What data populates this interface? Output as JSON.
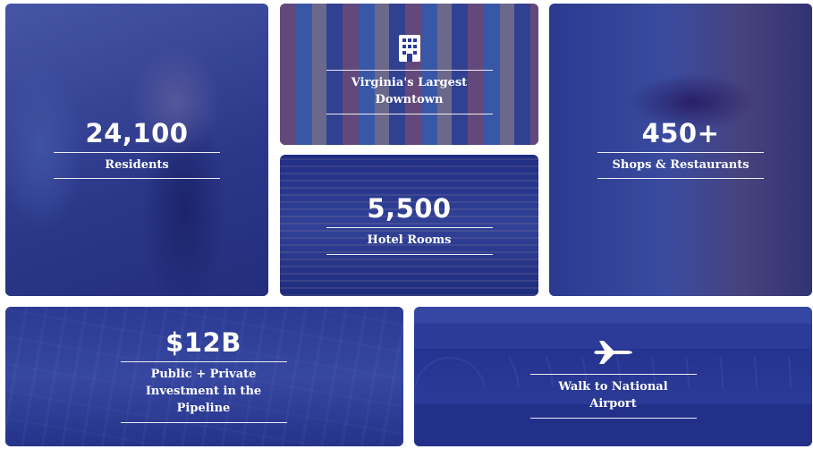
{
  "tiles": {
    "residents": {
      "stat": "24,100",
      "label": "Residents"
    },
    "downtown": {
      "label_line1": "Virginia's Largest",
      "label_line2": "Downtown",
      "icon": "building-icon"
    },
    "shops": {
      "stat": "450+",
      "label": "Shops & Restaurants"
    },
    "hotel": {
      "stat": "5,500",
      "label": "Hotel Rooms"
    },
    "investment": {
      "stat": "$12B",
      "label_line1": "Public + Private",
      "label_line2": "Investment in the",
      "label_line3": "Pipeline"
    },
    "airport": {
      "label": "Walk to National Airport",
      "icon": "airplane-icon"
    }
  },
  "colors": {
    "overlay": "#1e2da5",
    "text": "#ffffff"
  }
}
